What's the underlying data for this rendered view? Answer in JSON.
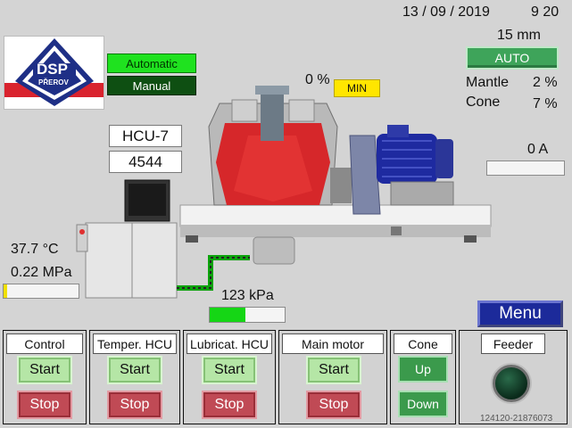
{
  "header": {
    "date": "13 / 09 / 2019",
    "time": "9 20"
  },
  "logo": {
    "brand": "DSP",
    "city": "PŘEROV"
  },
  "mode": {
    "automatic_label": "Automatic",
    "manual_label": "Manual"
  },
  "hcu": {
    "name": "HCU-7",
    "value": "4544"
  },
  "crusher": {
    "percent": "0 %",
    "min_label": "MIN"
  },
  "setting": {
    "gap": "15 mm",
    "auto_label": "AUTO",
    "mantle_label": "Mantle",
    "mantle_value": "2 %",
    "cone_label": "Cone",
    "cone_value": "7 %"
  },
  "motor": {
    "current": "0 A",
    "current_fraction": 0.0
  },
  "oil": {
    "temperature": "37.7 °C",
    "pressure": "0.22 MPa",
    "temperature_fraction": 0.05
  },
  "lube": {
    "pressure": "123 kPa",
    "pressure_fraction": 0.48
  },
  "menu_label": "Menu",
  "panels": {
    "control": {
      "title": "Control",
      "start": "Start",
      "stop": "Stop"
    },
    "temper_hcu": {
      "title": "Temper. HCU",
      "start": "Start",
      "stop": "Stop"
    },
    "lubricat_hcu": {
      "title": "Lubricat. HCU",
      "start": "Start",
      "stop": "Stop"
    },
    "main_motor": {
      "title": "Main motor",
      "start": "Start",
      "stop": "Stop"
    },
    "cone": {
      "title": "Cone",
      "up": "Up",
      "down": "Down"
    },
    "feeder": {
      "title": "Feeder"
    }
  },
  "watermark": "124120-21876073",
  "colors": {
    "background": "#d4d4d4",
    "auto_green": "#1fe21f",
    "manual_green": "#0e4f12",
    "menu_blue": "#1c2a9a",
    "min_yellow": "#ffe600"
  }
}
